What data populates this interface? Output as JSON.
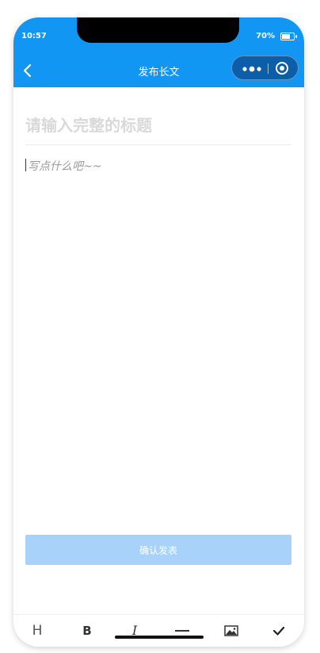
{
  "status": {
    "time": "10:57",
    "battery": "70%",
    "battery_level": 0.7
  },
  "nav": {
    "title": "发布长文"
  },
  "editor": {
    "title_placeholder": "请输入完整的标题",
    "content_placeholder": "写点什么吧~~"
  },
  "actions": {
    "confirm_label": "确认发表"
  },
  "toolbar": {
    "heading": "H",
    "bold": "B",
    "italic": "I"
  },
  "colors": {
    "primary": "#1296f3",
    "button_disabled": "#a8d2fa",
    "capsule": "#0d5ea8"
  }
}
